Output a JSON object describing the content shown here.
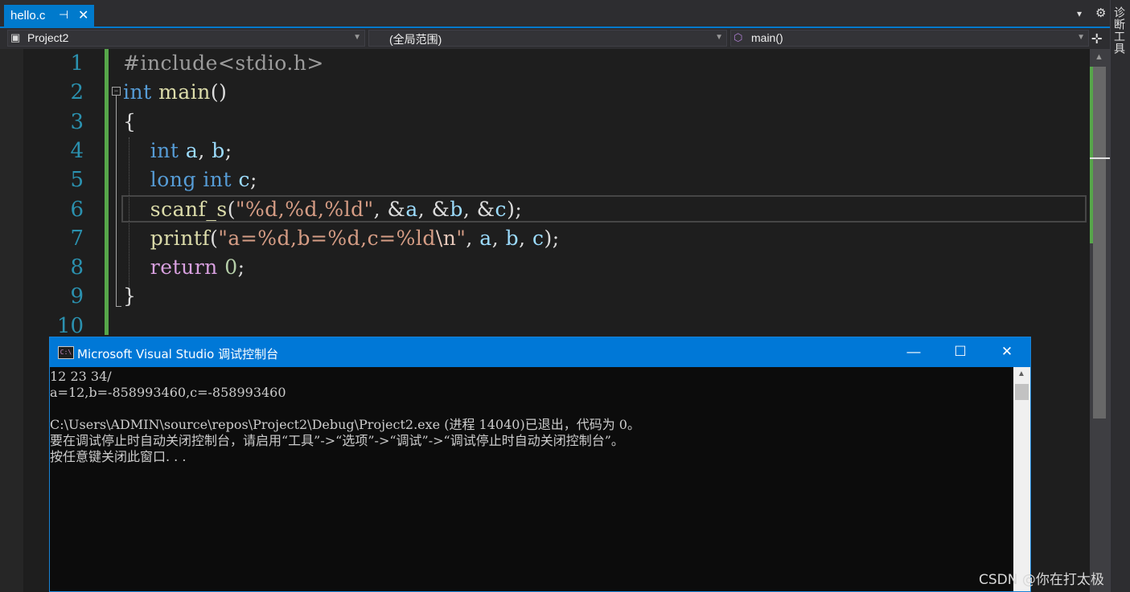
{
  "tab": {
    "title": "hello.c",
    "pin_glyph": "⊣",
    "close_glyph": "✕"
  },
  "toolbar": {
    "dropdown_glyph": "▾",
    "gear_glyph": "⚙",
    "split_glyph": "⊹"
  },
  "side_panel": {
    "label": "诊断工具"
  },
  "navbar": {
    "project": "Project2",
    "scope": "(全局范围)",
    "function": "main()"
  },
  "editor": {
    "line_numbers": [
      "1",
      "2",
      "3",
      "4",
      "5",
      "6",
      "7",
      "8",
      "9",
      "10"
    ],
    "lines": [
      [
        {
          "t": "#include<stdio.h>",
          "c": "p"
        }
      ],
      [
        {
          "t": "int",
          "c": "k"
        },
        {
          "t": " ",
          "c": ""
        },
        {
          "t": "main",
          "c": "f"
        },
        {
          "t": "()",
          "c": ""
        }
      ],
      [
        {
          "t": "{",
          "c": ""
        }
      ],
      [
        {
          "t": "    ",
          "c": ""
        },
        {
          "t": "int",
          "c": "k"
        },
        {
          "t": " ",
          "c": ""
        },
        {
          "t": "a",
          "c": "v"
        },
        {
          "t": ", ",
          "c": ""
        },
        {
          "t": "b",
          "c": "v"
        },
        {
          "t": ";",
          "c": ""
        }
      ],
      [
        {
          "t": "    ",
          "c": ""
        },
        {
          "t": "long",
          "c": "k"
        },
        {
          "t": " ",
          "c": ""
        },
        {
          "t": "int",
          "c": "k"
        },
        {
          "t": " ",
          "c": ""
        },
        {
          "t": "c",
          "c": "v"
        },
        {
          "t": ";",
          "c": ""
        }
      ],
      [
        {
          "t": "    ",
          "c": ""
        },
        {
          "t": "scanf_s",
          "c": "f"
        },
        {
          "t": "(",
          "c": ""
        },
        {
          "t": "\"%d,%d,%ld\"",
          "c": "s"
        },
        {
          "t": ", &",
          "c": ""
        },
        {
          "t": "a",
          "c": "v"
        },
        {
          "t": ", &",
          "c": ""
        },
        {
          "t": "b",
          "c": "v"
        },
        {
          "t": ", &",
          "c": ""
        },
        {
          "t": "c",
          "c": "v"
        },
        {
          "t": ");",
          "c": ""
        }
      ],
      [
        {
          "t": "    ",
          "c": ""
        },
        {
          "t": "printf",
          "c": "f"
        },
        {
          "t": "(",
          "c": ""
        },
        {
          "t": "\"a=%d,b=%d,c=%ld",
          "c": "s"
        },
        {
          "t": "\\n",
          "c": "esc"
        },
        {
          "t": "\"",
          "c": "s"
        },
        {
          "t": ", ",
          "c": ""
        },
        {
          "t": "a",
          "c": "v"
        },
        {
          "t": ", ",
          "c": ""
        },
        {
          "t": "b",
          "c": "v"
        },
        {
          "t": ", ",
          "c": ""
        },
        {
          "t": "c",
          "c": "v"
        },
        {
          "t": ");",
          "c": ""
        }
      ],
      [
        {
          "t": "    ",
          "c": ""
        },
        {
          "t": "return",
          "c": "r"
        },
        {
          "t": " ",
          "c": ""
        },
        {
          "t": "0",
          "c": "n"
        },
        {
          "t": ";",
          "c": ""
        }
      ],
      [
        {
          "t": "}",
          "c": ""
        }
      ],
      []
    ]
  },
  "console": {
    "title": "Microsoft Visual Studio 调试控制台",
    "icon_text": "C:\\",
    "minimize_glyph": "—",
    "maximize_glyph": "☐",
    "close_glyph": "✕",
    "output": "12 23 34/\na=12,b=-858993460,c=-858993460\n\nC:\\Users\\ADMIN\\source\\repos\\Project2\\Debug\\Project2.exe (进程 14040)已退出，代码为 0。\n要在调试停止时自动关闭控制台，请启用“工具”->“选项”->“调试”->“调试停止时自动关闭控制台”。\n按任意键关闭此窗口. . ."
  },
  "watermark": "CSDN @你在打太极",
  "colors": {
    "accent": "#007acc",
    "keyword": "#569cd6",
    "function": "#dcdcaa",
    "string": "#d69d85",
    "variable": "#9cdcfe",
    "line_number": "#2b91af",
    "change_bar": "#57a64a"
  }
}
